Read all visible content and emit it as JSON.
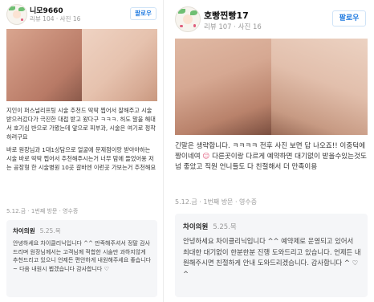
{
  "left": {
    "nickname": "니모9660",
    "meta": "리뷰 104 · 사진 16",
    "follow_label": "팔로우",
    "body_paragraphs": [
      "지인이 퍼스널리프팅 시술 추천드 딱딱 찝어서 잘해주고 시술 받으러갔다가 극진한 대접 받고 왔다구 ㅋㅋㅋ. 허도 말을 해대서 호기심 반으로 가봤는데 앞으로 피부과, 시술은 여기로 정착하려구요",
      "바로 원장님과 1대1상담으로 얼굴에 문제점이랑 받아야하는 시술 바로 딱딱 찝어서 추천해주시는거 너무 맘에 들었어용 저는 공장형 한 시술병원 10곳 갈바엔 이런곳 가보는거 추천해요"
    ],
    "footer": "5.12.금 · 1번째 방문 · 영수증",
    "reply": {
      "name": "차이의원",
      "date": "5.25.목",
      "text": "안녕하세요 차이클리닉입니다 ^^ 만족해주셔서 정말 감사드리며 원장님께서는 고객님께 적합한 시술만 과하지않게 추천드리고 있으니 언제든 편안하게 내원해주세요 좋습니다 ~ 다음 내원시 뵙겠습니다 감사합니다 ♡"
    }
  },
  "right": {
    "nickname": "호빵찐빵17",
    "meta": "리뷰 107 · 사진 16",
    "follow_label": "팔로우",
    "body_line1": "긴말은 생략합니다. ㅋㅋㅋㅋ 전후 사진 보면 답 나오죠!! 이중턱에 짱이네여",
    "body_line2": "다른곳이랑 다르게 예약하면 대기없이 받을수있는것도 넘 좋았고 직원 언니들도 다 친절해서 더 만족이용",
    "footer": "5.12.금 · 1번째 방문 · 영수증",
    "reply": {
      "name": "차이의원",
      "date": "5.25.목",
      "text": "안녕하세요 차이클리닉입니다 ^^ 예약제로 운영되고 있어서 최대한 대기없이 한분한분 진행 도와드리고 있습니다. 언제든 내원해주시면 친절하게 안내 도와드리겠습니다. 감사합니다 ^ ♡ ^"
    }
  },
  "colors": {
    "follow": "#1f7ae0",
    "reply_bg": "#f5f6f8",
    "meta": "#9a9a9a"
  }
}
